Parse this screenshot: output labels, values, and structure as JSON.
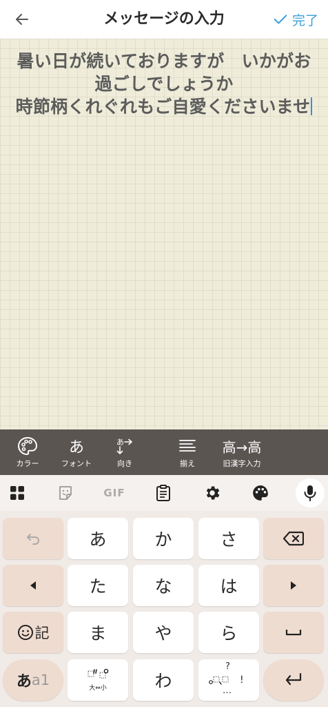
{
  "header": {
    "title": "メッセージの入力",
    "done_label": "完了"
  },
  "message": {
    "lines": [
      "暑い日が続いておりますが　いかがお",
      "過ごしでしょうか",
      "時節柄くれぐれもご自愛くださいませ"
    ]
  },
  "toolbar": {
    "items": [
      {
        "glyph": "",
        "label": "カラー"
      },
      {
        "glyph": "あ",
        "label": "フォント"
      },
      {
        "glyph": "あ→",
        "label": "向き"
      },
      {
        "glyph": "",
        "label": "揃え"
      },
      {
        "glyph": "高→高",
        "label": "旧漢字入力"
      }
    ]
  },
  "keyboard": {
    "top_icons": [
      "apps-grid-icon",
      "sticker-icon",
      "gif-icon",
      "clipboard-icon",
      "settings-gear-icon",
      "palette-icon",
      "microphone-icon"
    ],
    "gif_label": "GIF",
    "kana_rows": [
      [
        "あ",
        "か",
        "さ"
      ],
      [
        "た",
        "な",
        "は"
      ],
      [
        "ま",
        "や",
        "ら"
      ],
      [
        "",
        "わ",
        ""
      ]
    ],
    "kigou_label": "記",
    "mode_label_kana": "あ",
    "mode_label_alpha": "a1",
    "dakuten_small_label": "大⇔小",
    "punct_label_q": "?",
    "punct_label_ex": "!",
    "punct_label_dots": "…"
  },
  "colors": {
    "accent": "#3aa0da",
    "paper": "#efedda",
    "toolbar": "#5b5552",
    "side_key": "#efdcd0",
    "caret": "#3a8ee0"
  }
}
